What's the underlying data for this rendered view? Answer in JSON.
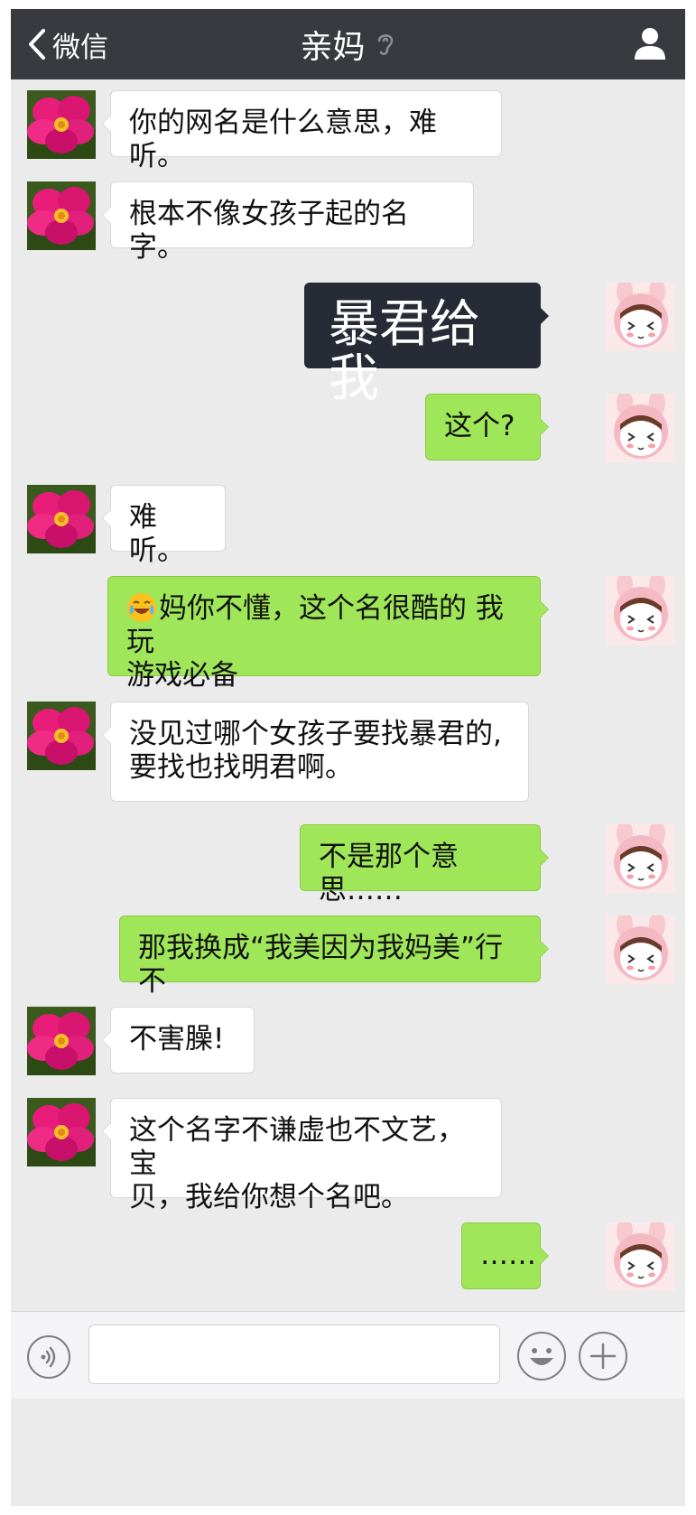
{
  "nav": {
    "back_label": "微信",
    "title": "亲妈",
    "icons": {
      "back": "chevron-left-icon",
      "ear": "ear-icon",
      "contact": "person-icon"
    }
  },
  "messages": [
    {
      "side": "left",
      "text": "你的网名是什么意思，难听。"
    },
    {
      "side": "left",
      "text": "根本不像女孩子起的名字。"
    },
    {
      "side": "right",
      "text": "暴君给我",
      "style": "dark"
    },
    {
      "side": "right",
      "text": "这个?"
    },
    {
      "side": "left",
      "text": "难听。"
    },
    {
      "side": "right",
      "text": "妈你不懂，这个名很酷的 我玩\n游戏必备",
      "emoji": "laugh-cry-emoji"
    },
    {
      "side": "left",
      "text": "没见过哪个女孩子要找暴君的,\n要找也找明君啊。"
    },
    {
      "side": "right",
      "text": "不是那个意思……"
    },
    {
      "side": "right",
      "text": "那我换成“我美因为我妈美”行不"
    },
    {
      "side": "left",
      "text": "不害臊!"
    },
    {
      "side": "left",
      "text": "这个名字不谦虚也不文艺，宝\n贝，我给你想个名吧。"
    },
    {
      "side": "right",
      "text": "……"
    }
  ],
  "avatars": {
    "left": "pink-flower-avatar",
    "right": "bunny-girl-avatar"
  },
  "input_bar": {
    "placeholder": "",
    "icons": {
      "voice": "voice-icon",
      "emoji": "smiley-icon",
      "more": "plus-icon"
    }
  },
  "colors": {
    "nav_background": "#393a3f",
    "chat_background": "#ebebeb",
    "sent_bubble": "#9fe659",
    "received_bubble": "#ffffff",
    "dark_bubble": "#262b35"
  }
}
